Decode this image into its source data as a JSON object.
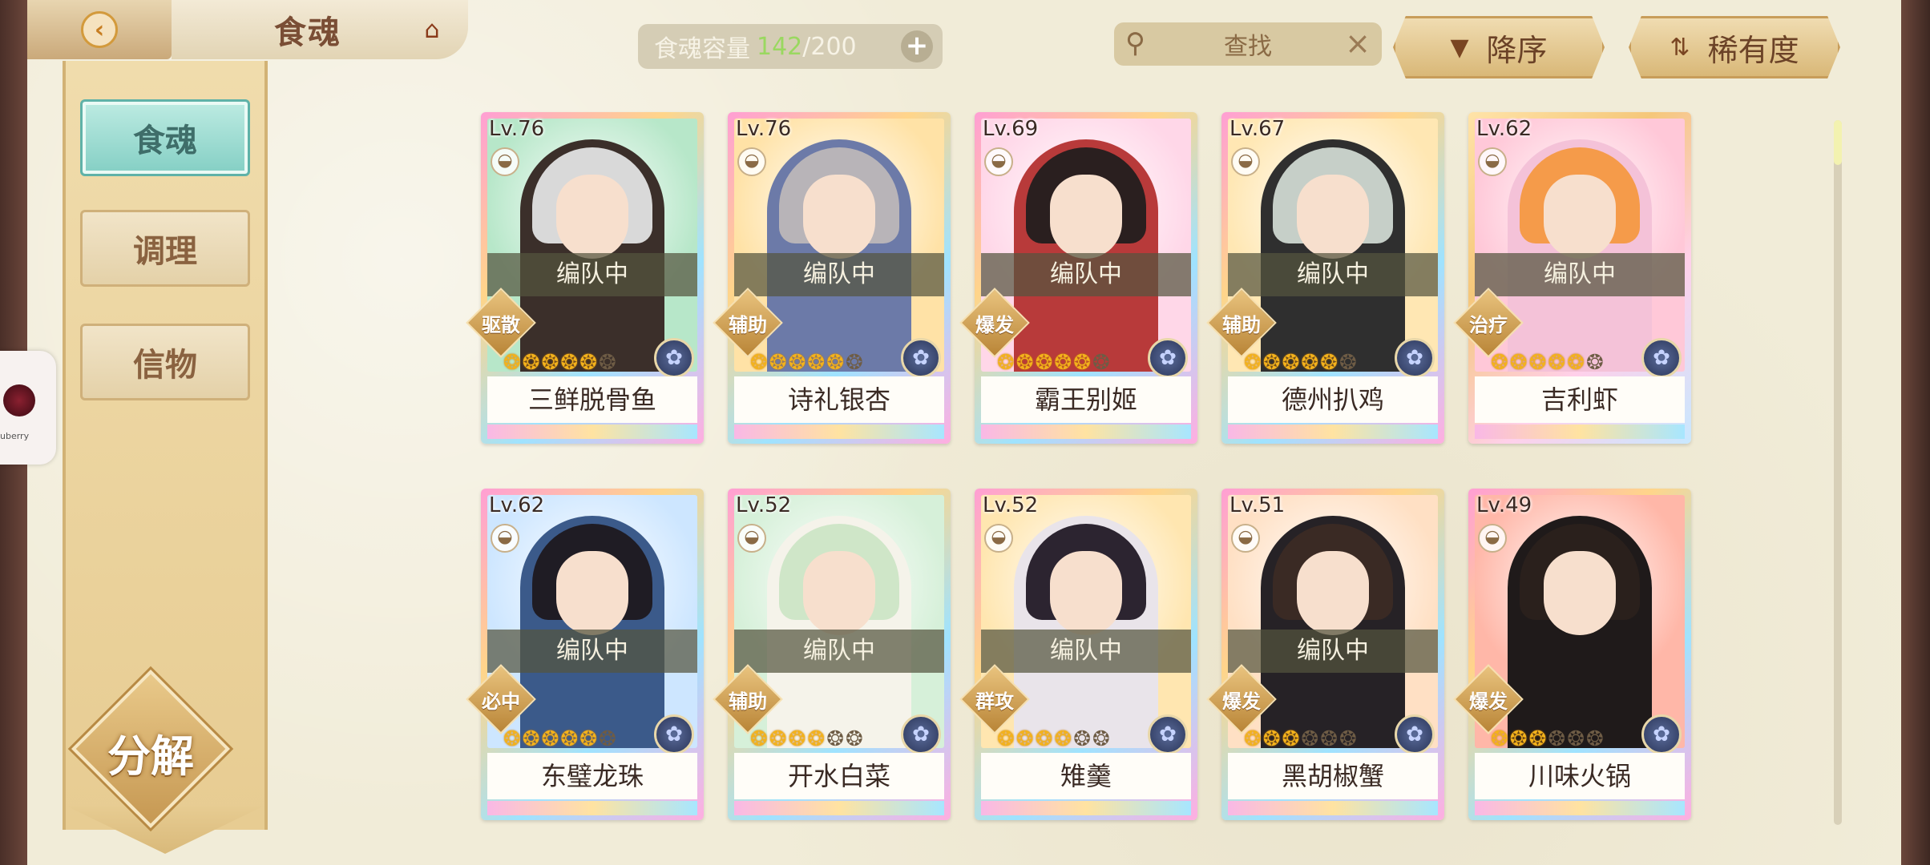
{
  "header": {
    "title": "食魂",
    "capacity_label": "食魂容量",
    "capacity_current": "142",
    "capacity_max": "/200",
    "search_placeholder": "查找",
    "sort_label": "降序",
    "rarity_label": "稀有度"
  },
  "sidebar": {
    "tabs": [
      {
        "label": "食魂",
        "active": true
      },
      {
        "label": "调理",
        "active": false
      },
      {
        "label": "信物",
        "active": false
      }
    ],
    "decompose_label": "分解"
  },
  "float_widget": {
    "text": "uberry"
  },
  "team_status": "编队中",
  "cards": [
    {
      "level": "Lv.76",
      "name": "三鲜脱骨鱼",
      "role": "驱散",
      "stars_on": 5,
      "stars_off": 1,
      "team": true,
      "bg": "#b7e7c9",
      "hair": "#d9d9d9",
      "outfit": "#3b2f2a"
    },
    {
      "level": "Lv.76",
      "name": "诗礼银杏",
      "role": "辅助",
      "stars_on": 5,
      "stars_off": 1,
      "team": true,
      "bg": "#ffe2a6",
      "hair": "#b8b4b8",
      "outfit": "#6c7aa8"
    },
    {
      "level": "Lv.69",
      "name": "霸王别姬",
      "role": "爆发",
      "stars_on": 5,
      "stars_off": 1,
      "team": true,
      "bg": "#ffd7e8",
      "hair": "#2a1f1f",
      "outfit": "#b83a3a"
    },
    {
      "level": "Lv.67",
      "name": "德州扒鸡",
      "role": "辅助",
      "stars_on": 5,
      "stars_off": 1,
      "team": true,
      "bg": "#ffe7b3",
      "hair": "#c6cfc8",
      "outfit": "#2f2f2f"
    },
    {
      "level": "Lv.62",
      "name": "吉利虾",
      "role": "治疗",
      "stars_on": 5,
      "stars_off": 1,
      "team": true,
      "bg": "#ffc8d8",
      "hair": "#f59b4a",
      "outfit": "#f4c2d8"
    },
    {
      "level": "Lv.62",
      "name": "东璧龙珠",
      "role": "必中",
      "stars_on": 5,
      "stars_off": 1,
      "team": true,
      "bg": "#cde6ff",
      "hair": "#1f1c24",
      "outfit": "#3b5a8a"
    },
    {
      "level": "Lv.52",
      "name": "开水白菜",
      "role": "辅助",
      "stars_on": 4,
      "stars_off": 2,
      "team": true,
      "bg": "#d6f0d9",
      "hair": "#cfe6c8",
      "outfit": "#f5f3ea"
    },
    {
      "level": "Lv.52",
      "name": "雉羹",
      "role": "群攻",
      "stars_on": 4,
      "stars_off": 2,
      "team": true,
      "bg": "#ffe6b0",
      "hair": "#2c2430",
      "outfit": "#e9e4ea"
    },
    {
      "level": "Lv.51",
      "name": "黑胡椒蟹",
      "role": "爆发",
      "stars_on": 3,
      "stars_off": 3,
      "team": true,
      "bg": "#ffe0c4",
      "hair": "#3a2a24",
      "outfit": "#262226"
    },
    {
      "level": "Lv.49",
      "name": "川味火锅",
      "role": "爆发",
      "stars_on": 3,
      "stars_off": 3,
      "team": false,
      "bg": "#ffb7a8",
      "hair": "#2a201c",
      "outfit": "#1f1a1a"
    }
  ]
}
